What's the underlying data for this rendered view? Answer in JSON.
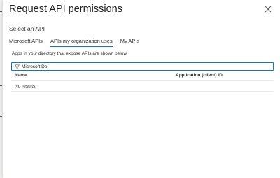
{
  "panel": {
    "title": "Request API permissions",
    "subtitle": "Select an API",
    "close_icon": "close-icon"
  },
  "tabs": [
    {
      "label": "Microsoft APIs",
      "active": false
    },
    {
      "label": "APIs my organization uses",
      "active": true
    },
    {
      "label": "My APIs",
      "active": false
    }
  ],
  "description": "Apps in your directory that expose APIs are shown below",
  "search": {
    "icon": "filter-icon",
    "value": "Microsoft De"
  },
  "table": {
    "columns": [
      "Name",
      "Application (client) ID"
    ],
    "empty_message": "No results."
  },
  "colors": {
    "accent": "#0078d4",
    "text": "#323130",
    "divider": "#edebe9"
  }
}
